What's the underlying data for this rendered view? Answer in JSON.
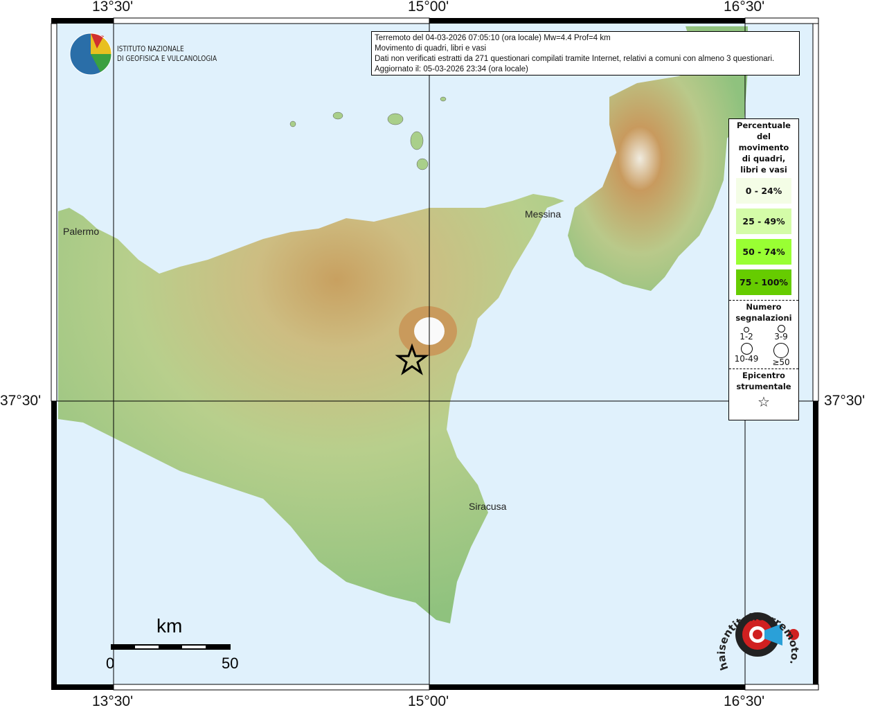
{
  "map": {
    "lon_labels": [
      "13°30'",
      "15°00'",
      "16°30'"
    ],
    "lat_label": "37°30'",
    "cities": [
      "Palermo",
      "Messina",
      "Siracusa"
    ],
    "institute": {
      "line1": "ISTITUTO NAZIONALE",
      "line2": "DI GEOFISICA E VULCANOLOGIA"
    },
    "scale": {
      "unit": "km",
      "start": "0",
      "end": "50"
    },
    "brand_logo_text": "haisentitoilterremoto.it www"
  },
  "info": {
    "line1": "Terremoto del 04-03-2026 07:05:10 (ora locale) Mw=4.4 Prof=4 km",
    "line2": "Movimento di quadri, libri e vasi",
    "line3": "Dati non verificati estratti da 271 questionari compilati tramite Internet, relativi a comuni con almeno 3 questionari.",
    "line4": "Aggiornato il: 05-03-2026 23:34 (ora locale)"
  },
  "legend": {
    "title": "Percentuale del movimento di quadri, libri e vasi",
    "classes": [
      {
        "label": "0 - 24%",
        "color": "#f4fde6"
      },
      {
        "label": "25 - 49%",
        "color": "#d4fca8"
      },
      {
        "label": "50 - 74%",
        "color": "#99ff33"
      },
      {
        "label": "75 - 100%",
        "color": "#66cc00"
      }
    ],
    "count_title": "Numero segnalazioni",
    "counts": [
      "1-2",
      "3-9",
      "10-49",
      "≥50"
    ],
    "epicenter_title": "Epicentro strumentale"
  }
}
